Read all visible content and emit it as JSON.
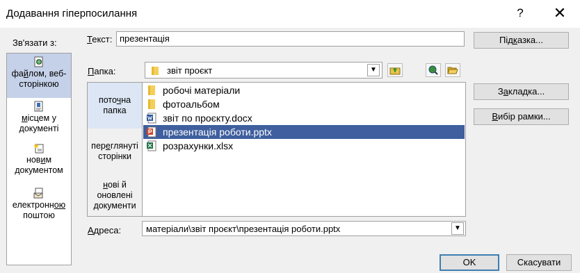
{
  "title": "Додавання гіперпосилання",
  "titlebar": {
    "help_glyph": "?",
    "close_glyph": "✕"
  },
  "link_to": {
    "label": "Зв'язати з:",
    "items": [
      {
        "pre": "фа",
        "u": "й",
        "post": "лом, веб-сторінкою",
        "icon": "file-web-icon",
        "selected": true
      },
      {
        "pre": "",
        "u": "м",
        "post": "ісцем у документі",
        "icon": "document-place-icon",
        "selected": false
      },
      {
        "pre": "нов",
        "u": "и",
        "post": "м документом",
        "icon": "new-document-icon",
        "selected": false
      },
      {
        "pre": "електронн",
        "u": "ою",
        "post": " поштою",
        "icon": "email-icon",
        "selected": false
      }
    ]
  },
  "text_field": {
    "label_u": "Т",
    "label_rest": "екст:",
    "value": "презентація"
  },
  "folder": {
    "label_u": "П",
    "label_rest": "апка:",
    "value": "звіт проєкт"
  },
  "look_in": [
    {
      "pre": "пото",
      "u": "ч",
      "post": "на папка"
    },
    {
      "pre": "пер",
      "u": "е",
      "post": "глянуті сторінки"
    },
    {
      "pre": "",
      "u": "н",
      "post": "ові й оновлені документи"
    }
  ],
  "files": [
    {
      "name": "робочі матеріали",
      "icon": "folder-icon",
      "selected": false
    },
    {
      "name": "фотоальбом",
      "icon": "folder-icon",
      "selected": false
    },
    {
      "name": "звіт по проєкту.docx",
      "icon": "word-icon",
      "selected": false
    },
    {
      "name": "презентація роботи.pptx",
      "icon": "powerpoint-icon",
      "selected": true
    },
    {
      "name": "розрахунки.xlsx",
      "icon": "excel-icon",
      "selected": false
    }
  ],
  "address": {
    "label_u": "А",
    "label_rest": "дреса:",
    "value": "матеріали\\звіт проєкт\\презентація роботи.pptx"
  },
  "buttons": {
    "tip": {
      "pre": "Під",
      "u": "к",
      "post": "азка..."
    },
    "bookmark": {
      "pre": "З",
      "u": "а",
      "post": "кладка..."
    },
    "frame": {
      "pre": "",
      "u": "В",
      "post": "ибір рамки..."
    },
    "ok": "OK",
    "cancel": "Скасувати"
  },
  "colors": {
    "selection": "#3f5f9e",
    "left_selected": "#c5d1e8",
    "ok_border": "#3c7fb1"
  }
}
